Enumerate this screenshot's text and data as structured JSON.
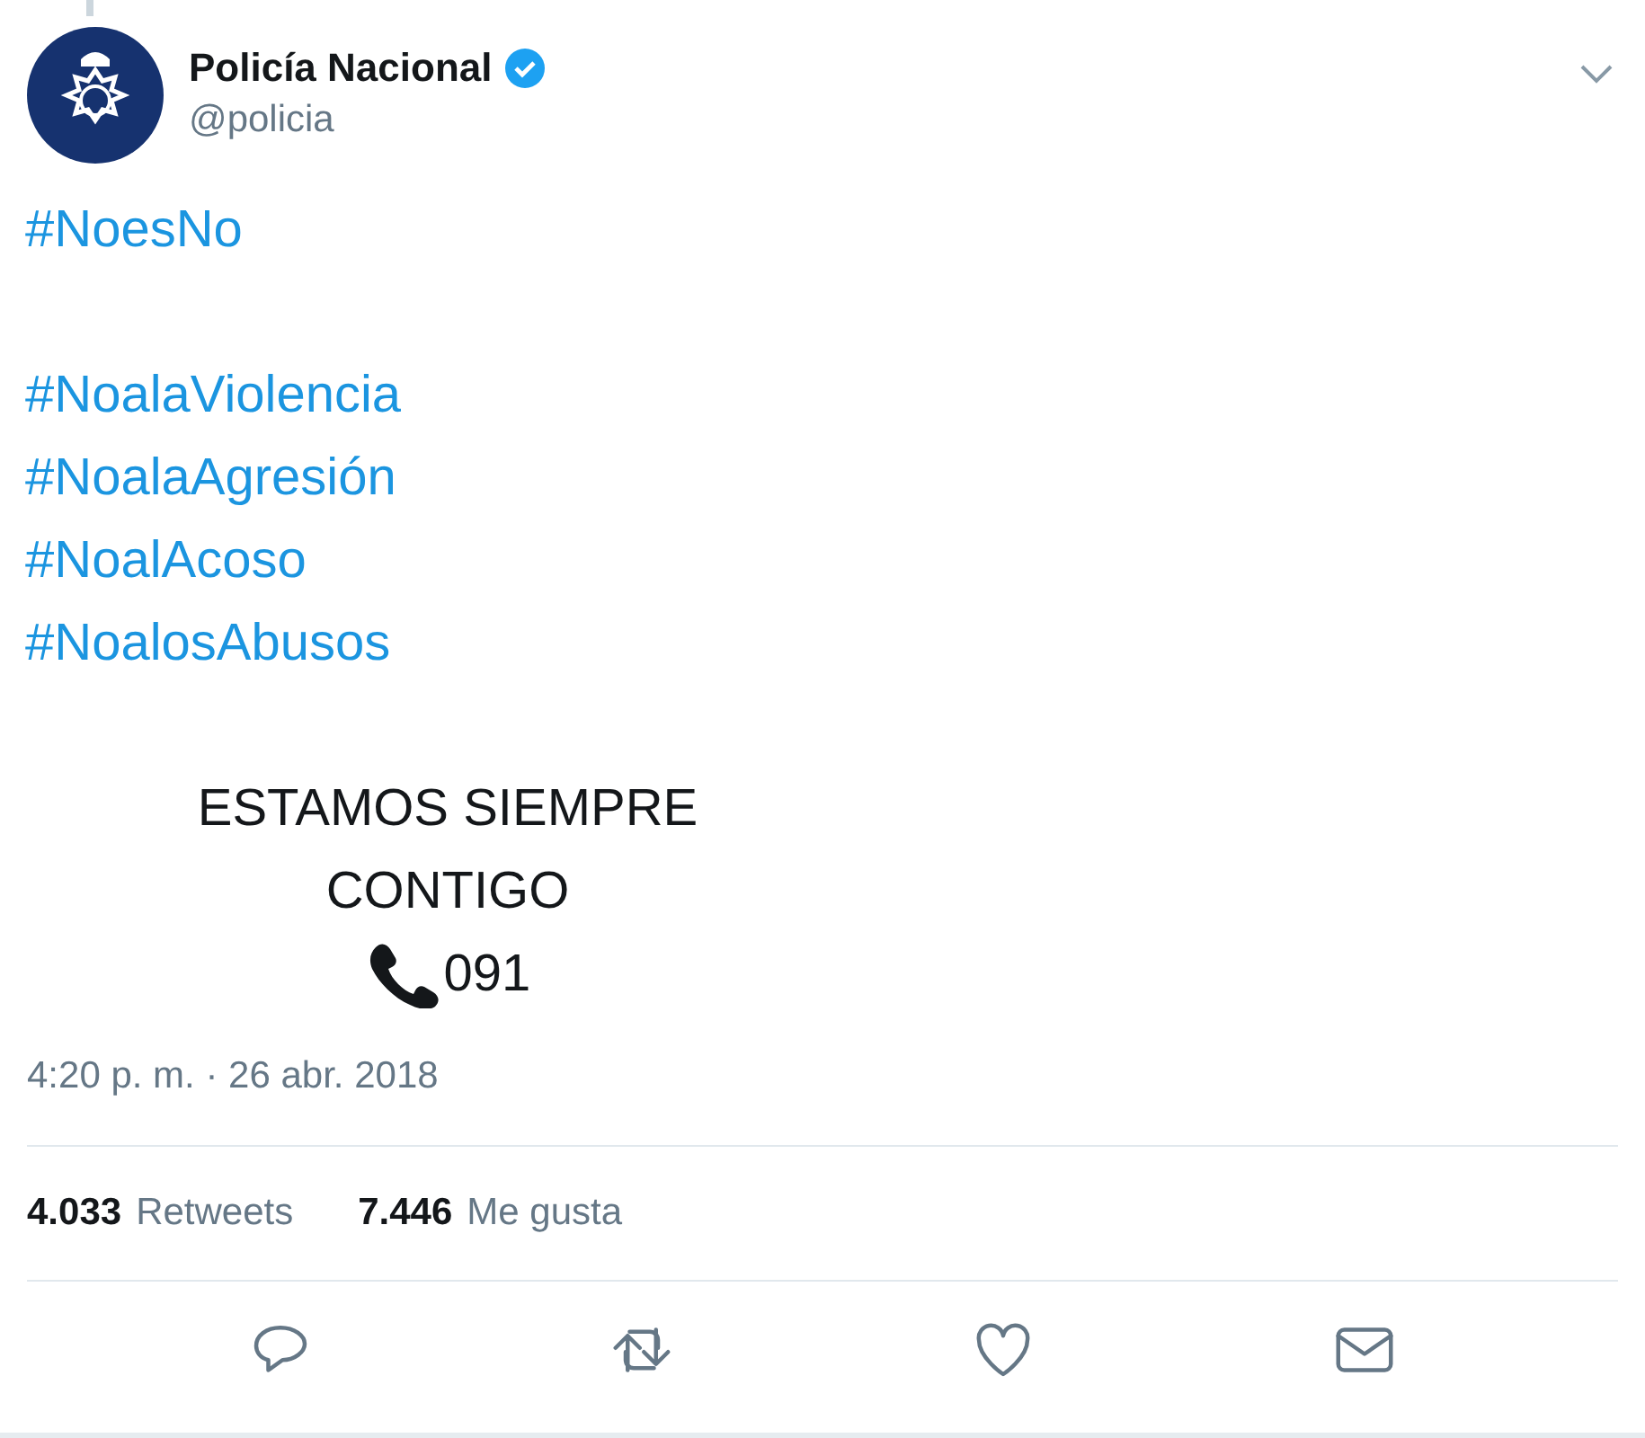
{
  "author": {
    "name": "Policía Nacional",
    "verified": true,
    "handle": "@policia"
  },
  "body": [
    {
      "kind": "hashtags",
      "lines": [
        "#NoesNo"
      ]
    },
    {
      "kind": "hashtags",
      "lines": [
        "#NoalaViolencia",
        "#NoalaAgresión",
        "#NoalAcoso",
        "#NoalosAbusos"
      ]
    },
    {
      "kind": "centered",
      "lines": [
        "ESTAMOS SIEMPRE",
        "CONTIGO"
      ],
      "phone": "091"
    }
  ],
  "timestamp": "4:20 p. m. · 26 abr. 2018",
  "stats": [
    {
      "count": "4.033",
      "label": "Retweets"
    },
    {
      "count": "7.446",
      "label": "Me gusta"
    }
  ],
  "actions": [
    {
      "kind": "reply"
    },
    {
      "kind": "retweet"
    },
    {
      "kind": "like"
    },
    {
      "kind": "message"
    }
  ]
}
